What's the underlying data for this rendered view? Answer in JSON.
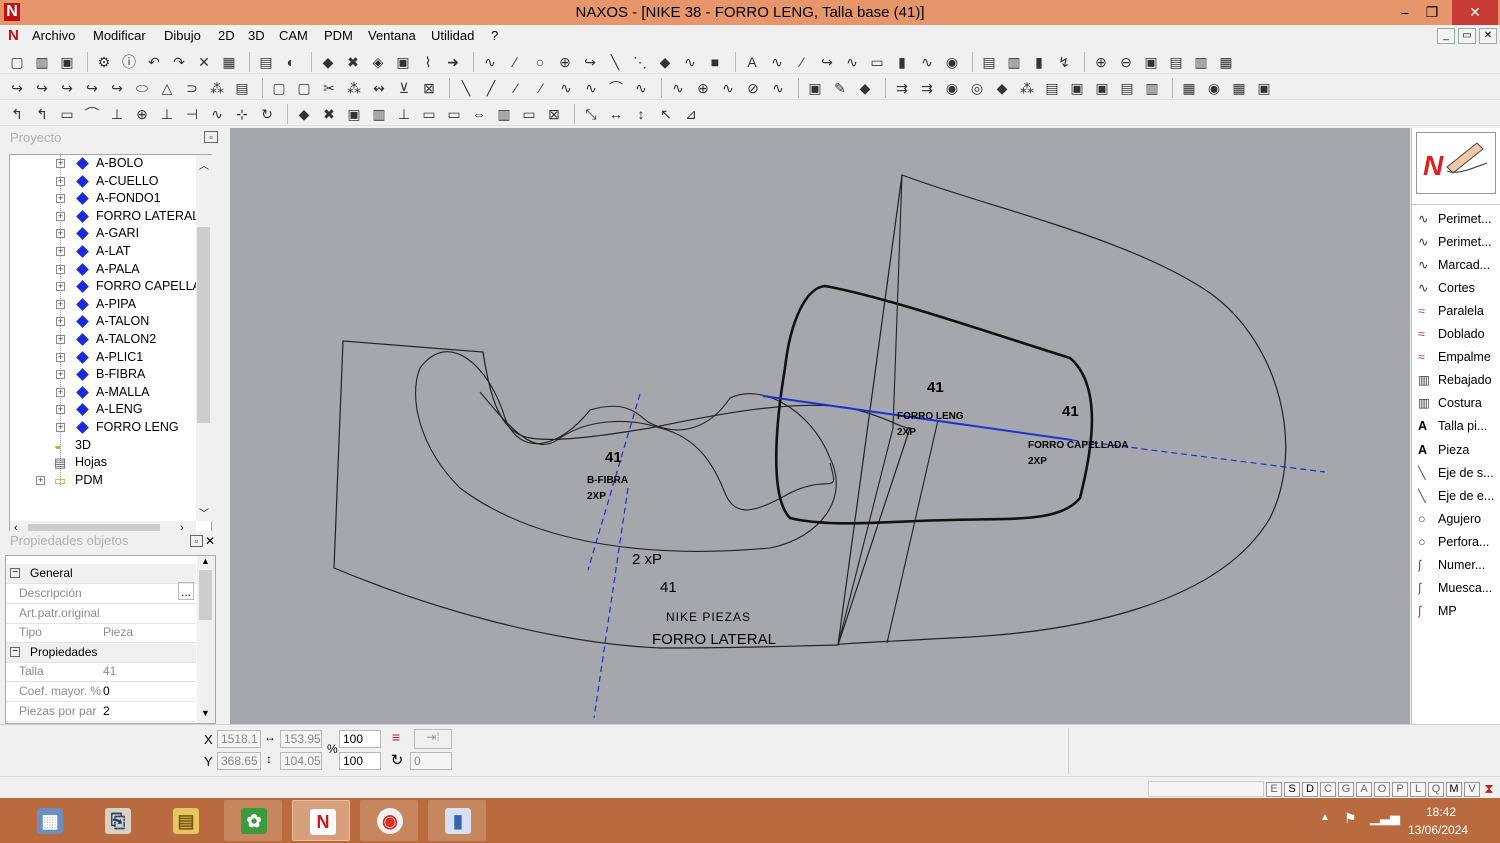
{
  "window": {
    "app_icon": "N",
    "title": "NAXOS - [NIKE 38 - FORRO LENG, Talla base (41)]",
    "controls": {
      "minimize": "–",
      "maximize": "❐",
      "close": "✕"
    }
  },
  "menu": {
    "items": [
      "Archivo",
      "Modificar",
      "Dibujo",
      "2D",
      "3D",
      "CAM",
      "PDM",
      "Ventana",
      "Utilidad",
      "?"
    ],
    "mdi_controls": [
      "_",
      "▭",
      "✕"
    ]
  },
  "project_panel": {
    "title": "Proyecto",
    "tree_items": [
      {
        "label": "A-BOLO",
        "type": "piece"
      },
      {
        "label": "A-CUELLO",
        "type": "piece"
      },
      {
        "label": "A-FONDO1",
        "type": "piece"
      },
      {
        "label": "FORRO LATERAL",
        "type": "piece"
      },
      {
        "label": "A-GARI",
        "type": "piece"
      },
      {
        "label": "A-LAT",
        "type": "piece"
      },
      {
        "label": "A-PALA",
        "type": "piece"
      },
      {
        "label": "FORRO CAPELLA",
        "type": "piece"
      },
      {
        "label": "A-PIPA",
        "type": "piece"
      },
      {
        "label": "A-TALON",
        "type": "piece"
      },
      {
        "label": "A-TALON2",
        "type": "piece"
      },
      {
        "label": "A-PLIC1",
        "type": "piece"
      },
      {
        "label": "B-FIBRA",
        "type": "piece"
      },
      {
        "label": "A-MALLA",
        "type": "piece"
      },
      {
        "label": "A-LENG",
        "type": "piece"
      },
      {
        "label": "FORRO LENG",
        "type": "piece"
      }
    ],
    "extra_items": [
      {
        "label": "3D",
        "icon": "3d-icon"
      },
      {
        "label": "Hojas",
        "icon": "sheets-icon"
      },
      {
        "label": "PDM",
        "icon": "folder-icon"
      }
    ]
  },
  "properties_panel": {
    "title": "Propiedades objetos",
    "sections": [
      {
        "label": "General"
      },
      {
        "label": "Propiedades"
      }
    ],
    "rows": [
      {
        "key": "Descripción",
        "value": ""
      },
      {
        "key": "Art.patr.original",
        "value": ""
      },
      {
        "key": "Tipo",
        "value": "Pieza"
      },
      {
        "key": "Talla",
        "value": "41"
      },
      {
        "key": "Coef. mayor. %",
        "value": "0"
      },
      {
        "key": "Piezas por par",
        "value": "2"
      }
    ],
    "ellipsis": "..."
  },
  "canvas": {
    "labels": {
      "size_left": "41",
      "bfibra": "B-FIBRA",
      "bfibra_qty": "2XP",
      "forro_leng": "FORRO LENG",
      "forro_leng_qty": "2XP",
      "size_center": "41",
      "size_right": "41",
      "forro_capellada": "FORRO CAPELLADA",
      "forro_capellada_qty": "2XP",
      "qty_lateral": "2 xP",
      "size_lateral": "41",
      "nike_piezas": "NIKE PIEZAS",
      "forro_lateral": "FORRO LATERAL"
    }
  },
  "right_panel": {
    "items": [
      {
        "label": "Perimet...",
        "icon": "curve-icon"
      },
      {
        "label": "Perimet...",
        "icon": "curve-icon"
      },
      {
        "label": "Marcad...",
        "icon": "curve-icon"
      },
      {
        "label": "Cortes",
        "icon": "curve-icon"
      },
      {
        "label": "Paralela",
        "icon": "parallel-icon"
      },
      {
        "label": "Doblado",
        "icon": "parallel-icon"
      },
      {
        "label": "Empalme",
        "icon": "parallel-icon"
      },
      {
        "label": "Rebajado",
        "icon": "skive-icon"
      },
      {
        "label": "Costura",
        "icon": "skive-icon"
      },
      {
        "label": "Talla pi...",
        "icon": "text-a-icon"
      },
      {
        "label": "Pieza",
        "icon": "text-a-icon"
      },
      {
        "label": "Eje de s...",
        "icon": "axis-icon"
      },
      {
        "label": "Eje de e...",
        "icon": "axis-icon"
      },
      {
        "label": "Agujero",
        "icon": "circle-icon"
      },
      {
        "label": "Perfora...",
        "icon": "circle-icon"
      },
      {
        "label": "Numer...",
        "icon": "pen-icon"
      },
      {
        "label": "Muesca...",
        "icon": "pen-icon"
      },
      {
        "label": "MP",
        "icon": "pen-icon"
      }
    ]
  },
  "status": {
    "x_label": "X",
    "y_label": "Y",
    "x_value": "1518.1",
    "y_value": "368.65",
    "width_value": "153.95",
    "height_value": "104.05",
    "scale_x": "100",
    "scale_y": "100",
    "percent": "%",
    "angle_value": "0",
    "flags": [
      "E",
      "S",
      "D",
      "C",
      "G",
      "A",
      "O",
      "P",
      "L",
      "Q",
      "M",
      "V"
    ]
  },
  "taskbar": {
    "time": "18:42",
    "date": "13/06/2024",
    "apps": [
      "calculator",
      "file-explorer-remote",
      "file-explorer",
      "green-app",
      "naxos",
      "chrome",
      "paint-app"
    ]
  }
}
